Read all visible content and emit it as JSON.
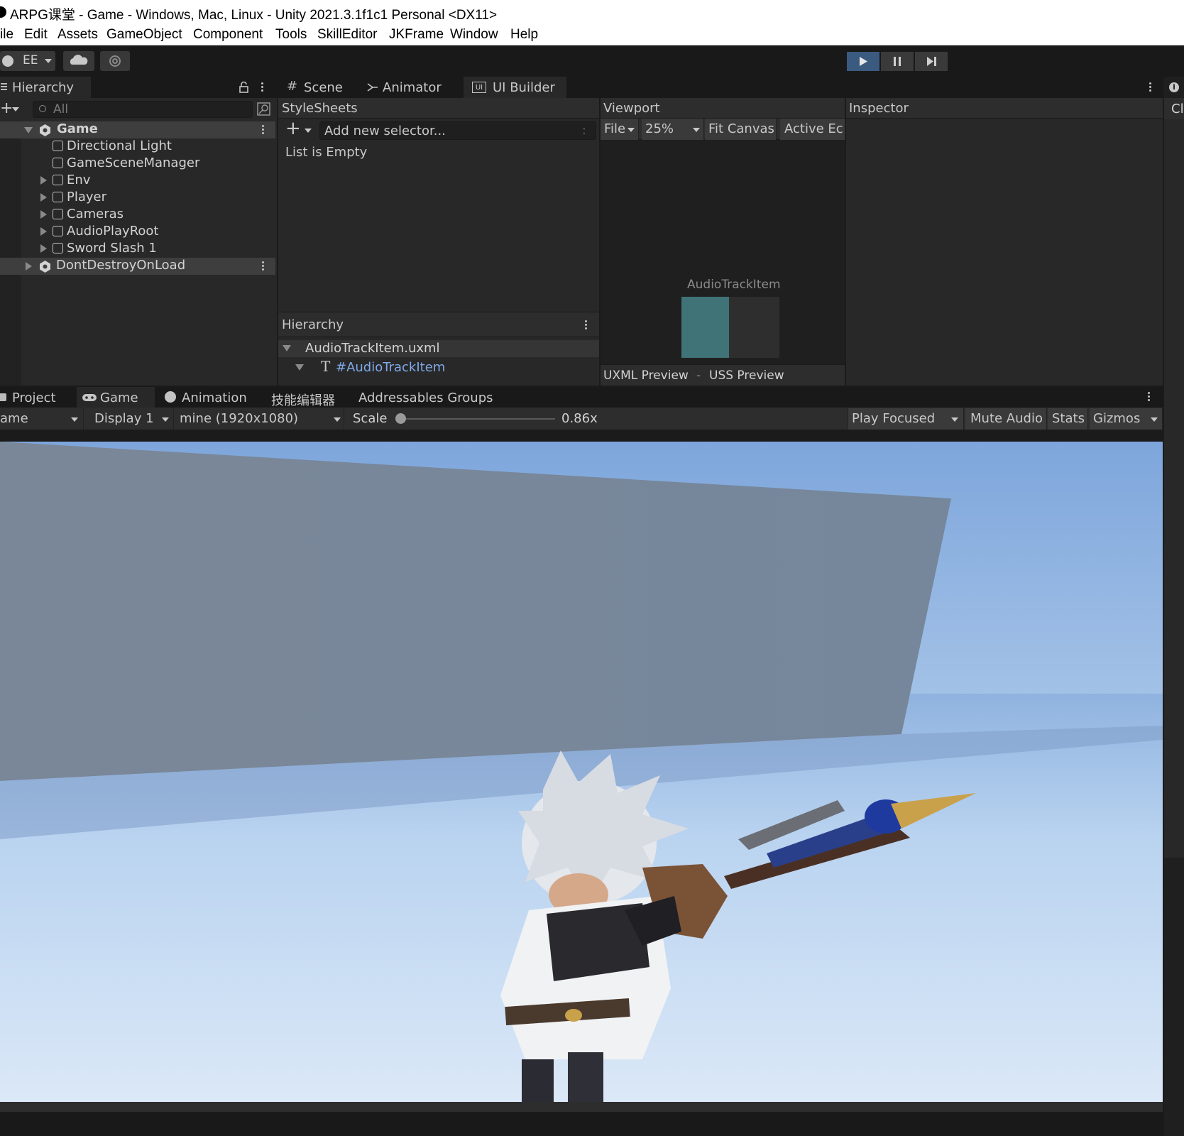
{
  "window": {
    "title": "ARPG课堂 - Game - Windows, Mac, Linux - Unity 2021.3.1f1c1 Personal <DX11>"
  },
  "menu": [
    "ile",
    "Edit",
    "Assets",
    "GameObject",
    "Component",
    "Tools",
    "SkillEditor",
    "JKFrame",
    "Window",
    "Help"
  ],
  "toolbar": {
    "account": "EE"
  },
  "hierarchy": {
    "tab": "Hierarchy",
    "search_placeholder": "All",
    "scene": "Game",
    "items": [
      "Directional Light",
      "GameSceneManager",
      "Env",
      "Player",
      "Cameras",
      "AudioPlayRoot",
      "Sword Slash 1"
    ],
    "dontdestroy": "DontDestroyOnLoad"
  },
  "center_tabs": {
    "scene": "Scene",
    "animator": "Animator",
    "uibuilder": "UI Builder"
  },
  "stylesheets": {
    "title": "StyleSheets",
    "selector_placeholder": "Add new selector...",
    "selector_more": ":",
    "empty": "List is Empty"
  },
  "ui_hierarchy": {
    "title": "Hierarchy",
    "file": "AudioTrackItem.uxml",
    "element": "#AudioTrackItem",
    "glyph": "T"
  },
  "viewport": {
    "title": "Viewport",
    "file": "File",
    "zoom": "25%",
    "fit": "Fit Canvas",
    "active": "Active Ec",
    "canvas_label": "AudioTrackItem",
    "uxml_preview": "UXML Preview",
    "separator": "-",
    "uss_preview": "USS Preview"
  },
  "inspector": {
    "title": "Inspector",
    "side_tab": "Cl"
  },
  "bottom_tabs": {
    "project": "Project",
    "game": "Game",
    "animation": "Animation",
    "skill": "技能编辑器",
    "addressables": "Addressables Groups"
  },
  "game_toolbar": {
    "mode": "ame",
    "display": "Display 1",
    "resolution": "mine (1920x1080)",
    "scale_label": "Scale",
    "scale_value": "0.86x",
    "play_focused": "Play Focused",
    "mute": "Mute Audio",
    "stats": "Stats",
    "gizmos": "Gizmos"
  },
  "colors": {
    "accent": "#4a7fc4",
    "selection": "#2c5d87",
    "link": "#7fa9e8",
    "teal": "#3f7378"
  }
}
